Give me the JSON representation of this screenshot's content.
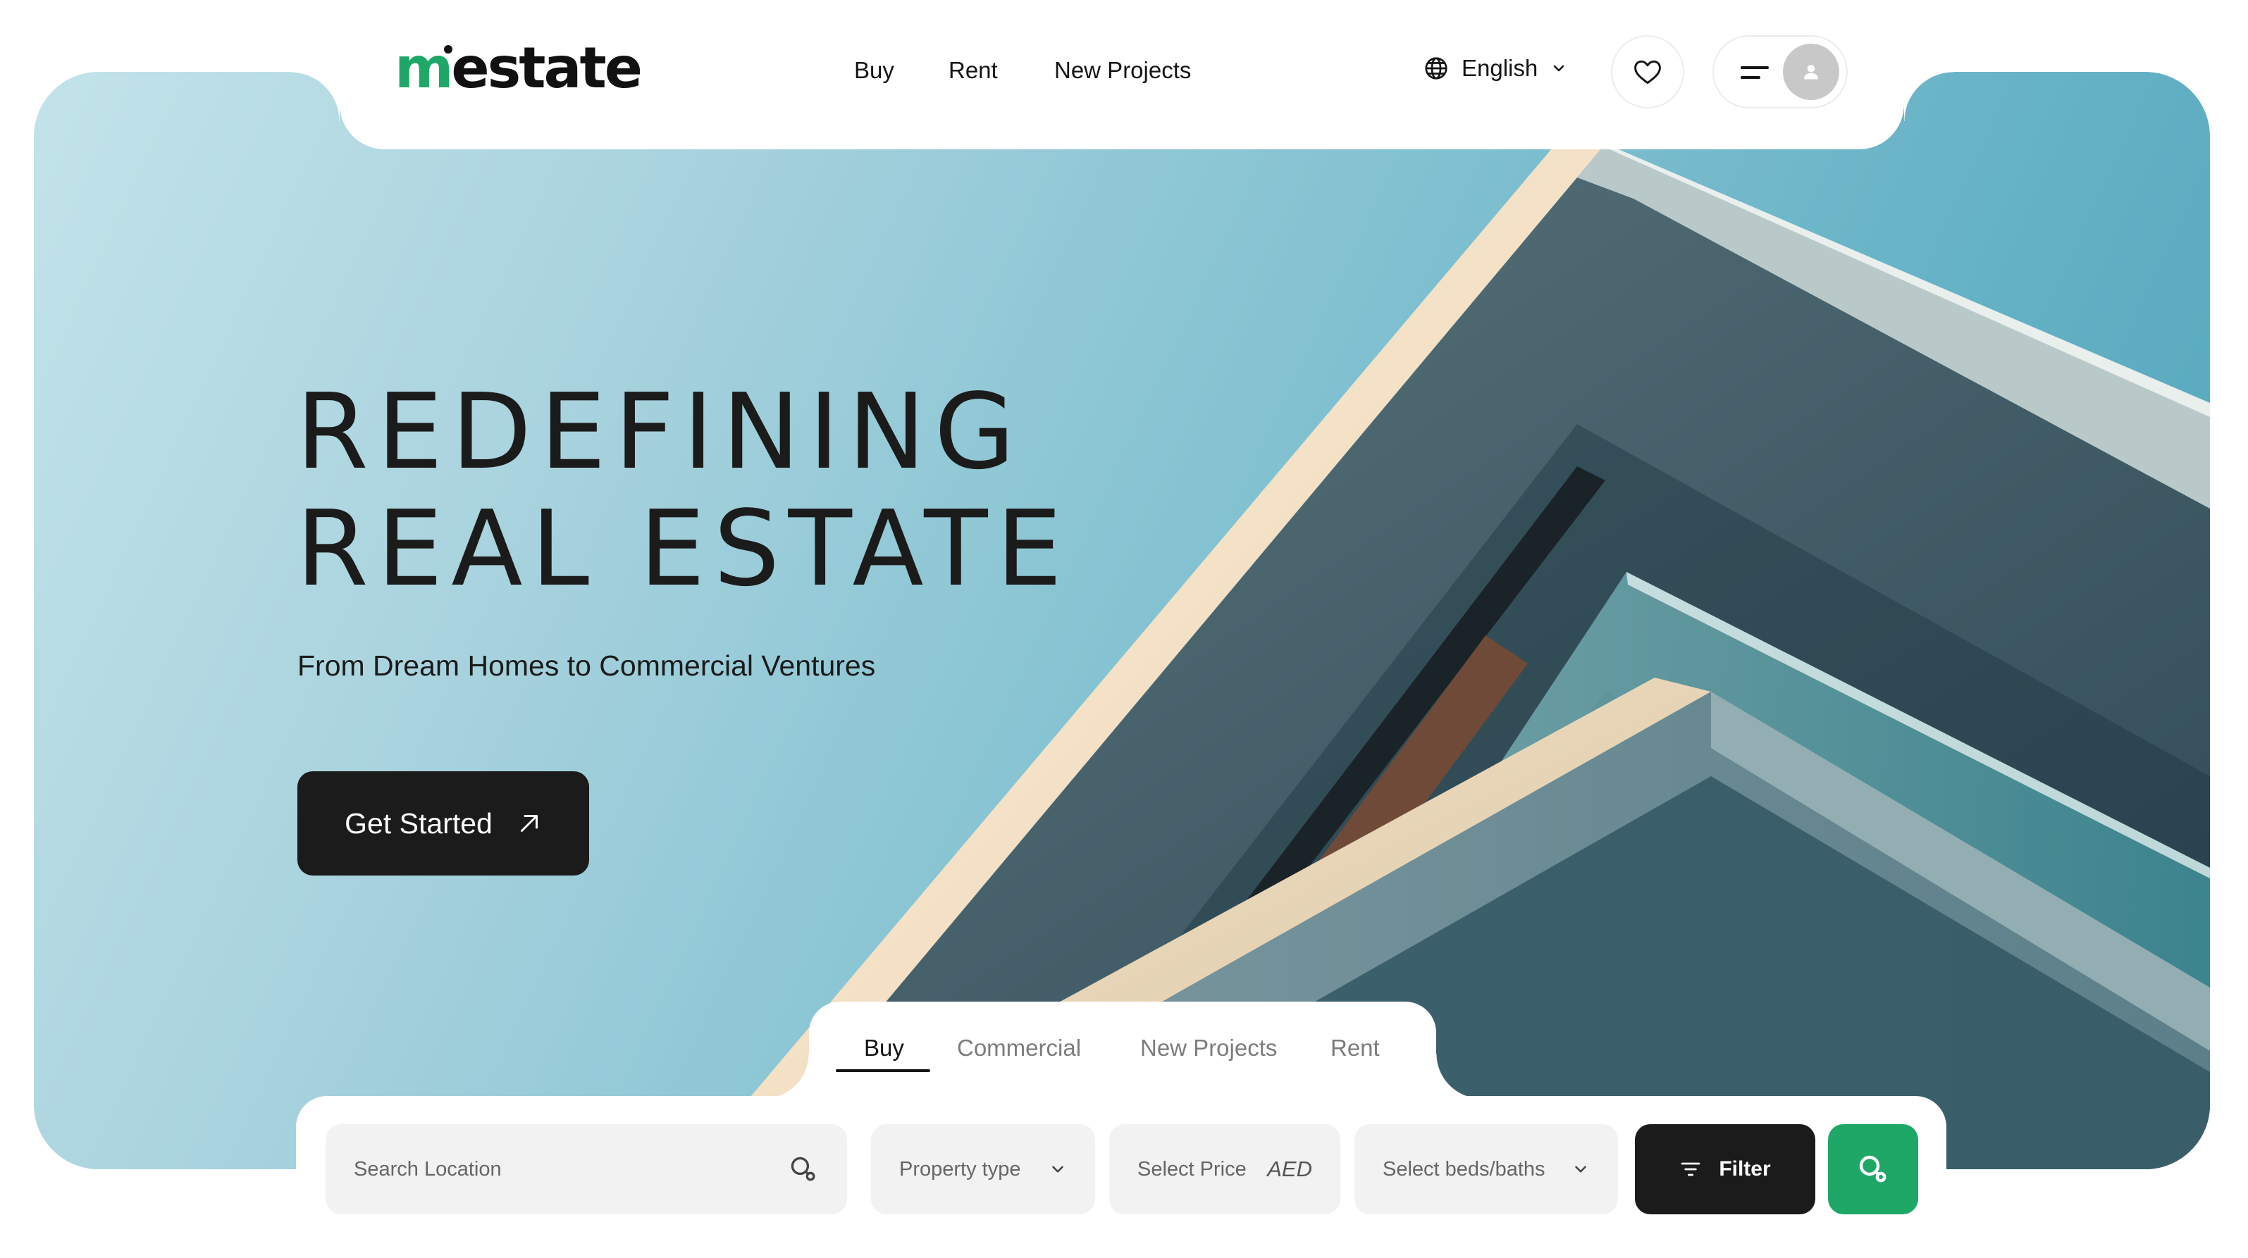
{
  "brand": {
    "logo_text": "mestate",
    "logo_accent_letter": "m",
    "logo_rest": "estate",
    "accent_color": "#1fa768"
  },
  "nav": {
    "links": [
      {
        "label": "Buy"
      },
      {
        "label": "Rent"
      },
      {
        "label": "New Projects"
      }
    ],
    "language": {
      "label": "English",
      "icon": "globe-icon"
    },
    "favorites_icon": "heart-icon",
    "menu_icon": "menu-icon",
    "avatar_icon": "user-icon"
  },
  "hero": {
    "headline_line1": "REDEFINING",
    "headline_line2": "REAL ESTATE",
    "subheadline": "From Dream Homes to Commercial Ventures",
    "cta_label": "Get Started",
    "cta_icon": "arrow-up-right-icon"
  },
  "search": {
    "tabs": [
      {
        "label": "Buy",
        "active": true
      },
      {
        "label": "Commercial",
        "active": false
      },
      {
        "label": "New Projects",
        "active": false
      },
      {
        "label": "Rent",
        "active": false
      }
    ],
    "location_placeholder": "Search Location",
    "property_type_label": "Property type",
    "price_label": "Select Price",
    "currency": "AED",
    "beds_baths_label": "Select beds/baths",
    "filter_label": "Filter",
    "search_icon": "search-icon"
  },
  "colors": {
    "dark": "#1b1b1b",
    "sky_light": "#c3e3ea",
    "sky_dark": "#4fa2b8",
    "field_bg": "#f2f2f2"
  }
}
